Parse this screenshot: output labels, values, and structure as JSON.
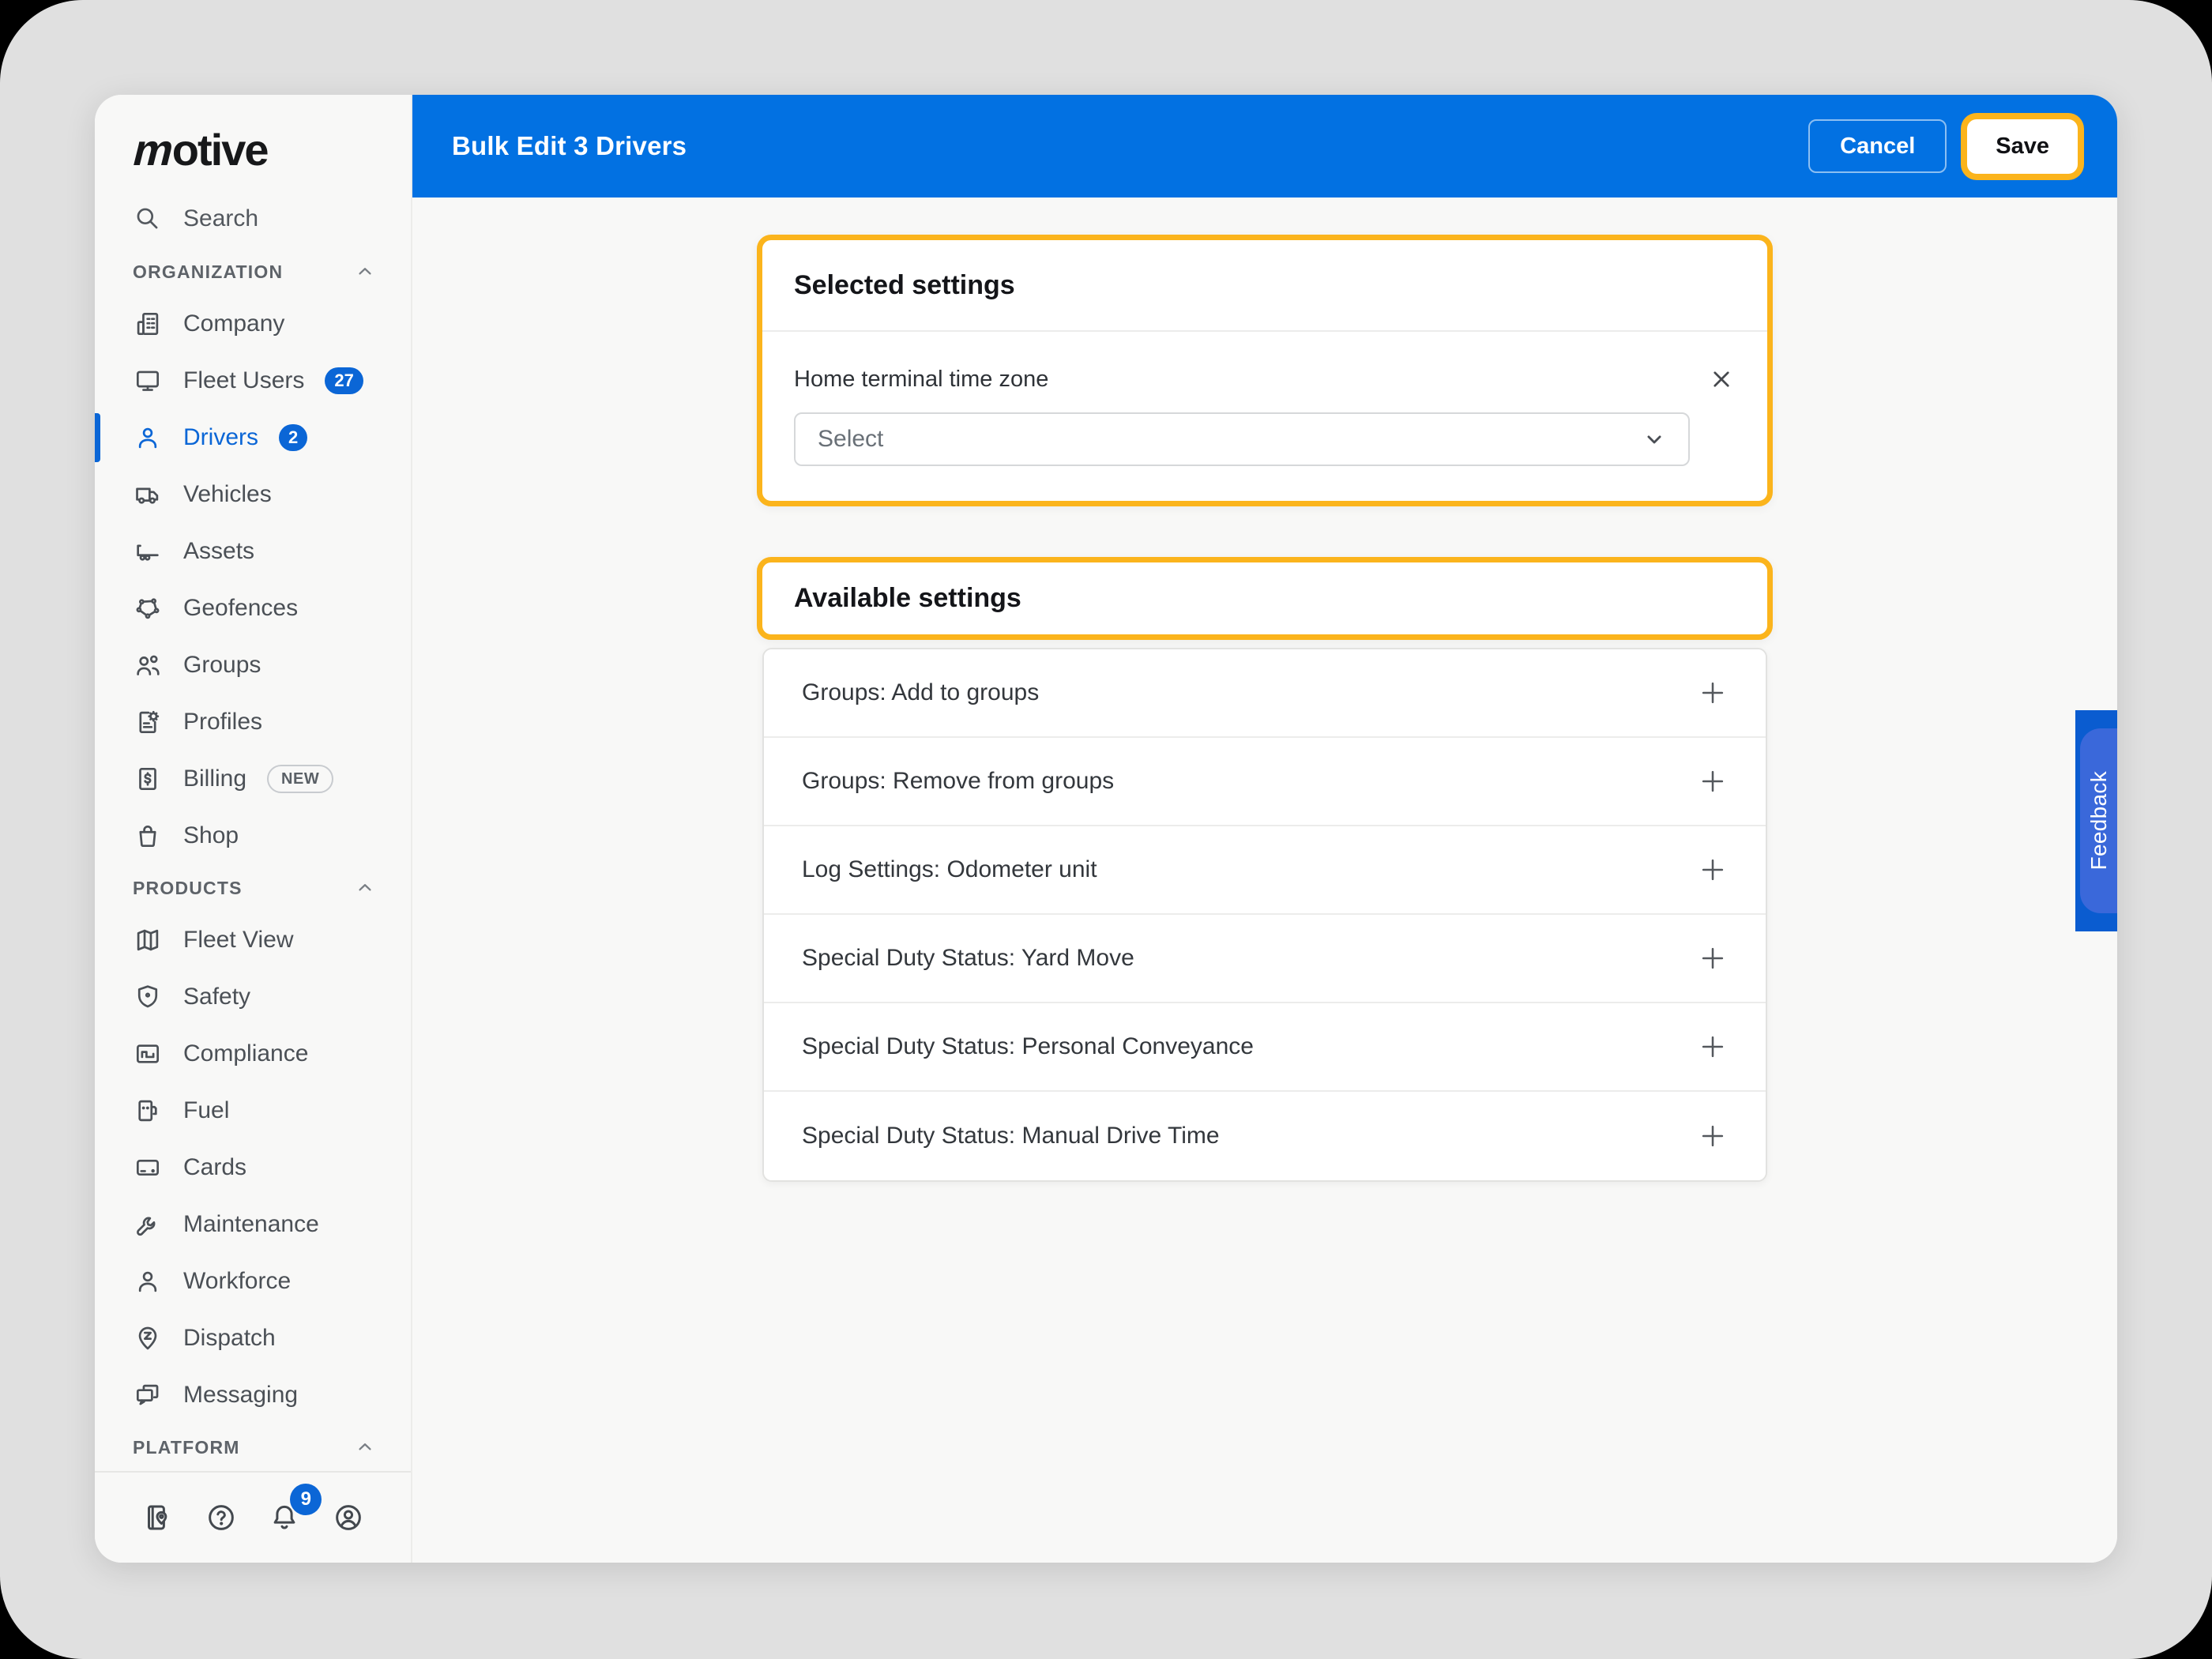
{
  "brand": {
    "logo": "motive"
  },
  "header": {
    "title": "Bulk Edit 3 Drivers",
    "cancel_label": "Cancel",
    "save_label": "Save"
  },
  "sidebar": {
    "search": {
      "label": "Search"
    },
    "sections": [
      {
        "label": "ORGANIZATION",
        "items": [
          {
            "label": "Company"
          },
          {
            "label": "Fleet Users",
            "badge": "27"
          },
          {
            "label": "Drivers",
            "badge": "2",
            "active": true
          },
          {
            "label": "Vehicles"
          },
          {
            "label": "Assets"
          },
          {
            "label": "Geofences"
          },
          {
            "label": "Groups"
          },
          {
            "label": "Profiles"
          },
          {
            "label": "Billing",
            "tag": "NEW"
          },
          {
            "label": "Shop"
          }
        ]
      },
      {
        "label": "PRODUCTS",
        "items": [
          {
            "label": "Fleet View"
          },
          {
            "label": "Safety"
          },
          {
            "label": "Compliance"
          },
          {
            "label": "Fuel"
          },
          {
            "label": "Cards"
          },
          {
            "label": "Maintenance"
          },
          {
            "label": "Workforce"
          },
          {
            "label": "Dispatch"
          },
          {
            "label": "Messaging"
          }
        ]
      },
      {
        "label": "PLATFORM",
        "items": []
      }
    ],
    "footer": {
      "notification_count": "9"
    }
  },
  "selected_settings": {
    "title": "Selected settings",
    "field_label": "Home terminal time zone",
    "select_placeholder": "Select"
  },
  "available_settings": {
    "title": "Available settings",
    "items": [
      "Groups: Add to groups",
      "Groups: Remove from groups",
      "Log Settings: Odometer unit",
      "Special Duty Status: Yard Move",
      "Special Duty Status: Personal Conveyance",
      "Special Duty Status: Manual Drive Time"
    ]
  },
  "feedback": {
    "label": "Feedback"
  },
  "colors": {
    "header_blue": "#0271E2",
    "accent_blue": "#0B66D6",
    "focus_yellow": "#FBB41C",
    "desktop_gray": "#E0E0E0"
  }
}
